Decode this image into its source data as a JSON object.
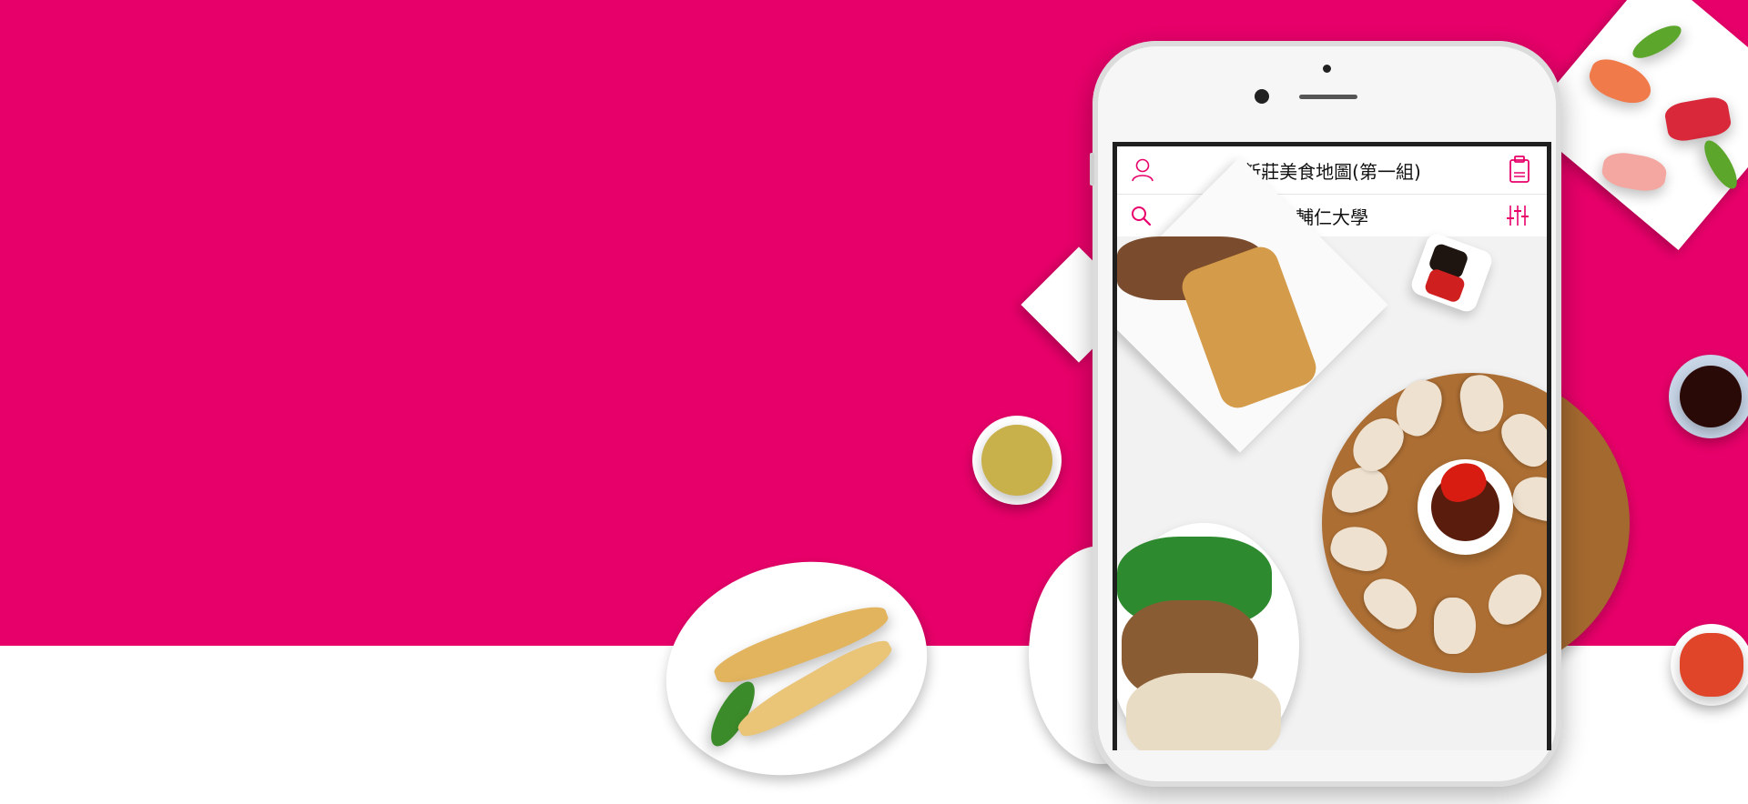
{
  "app": {
    "header_title": "新莊美食地圖(第一組)",
    "location_label": "輔仁大學"
  },
  "icons": {
    "profile": "user-outline-icon",
    "cart": "clipboard-bag-icon",
    "search": "search-icon",
    "filter": "sliders-icon"
  },
  "colors": {
    "brand_pink": "#e8006a",
    "icon_pink": "#e8006a",
    "background_white": "#ffffff"
  }
}
